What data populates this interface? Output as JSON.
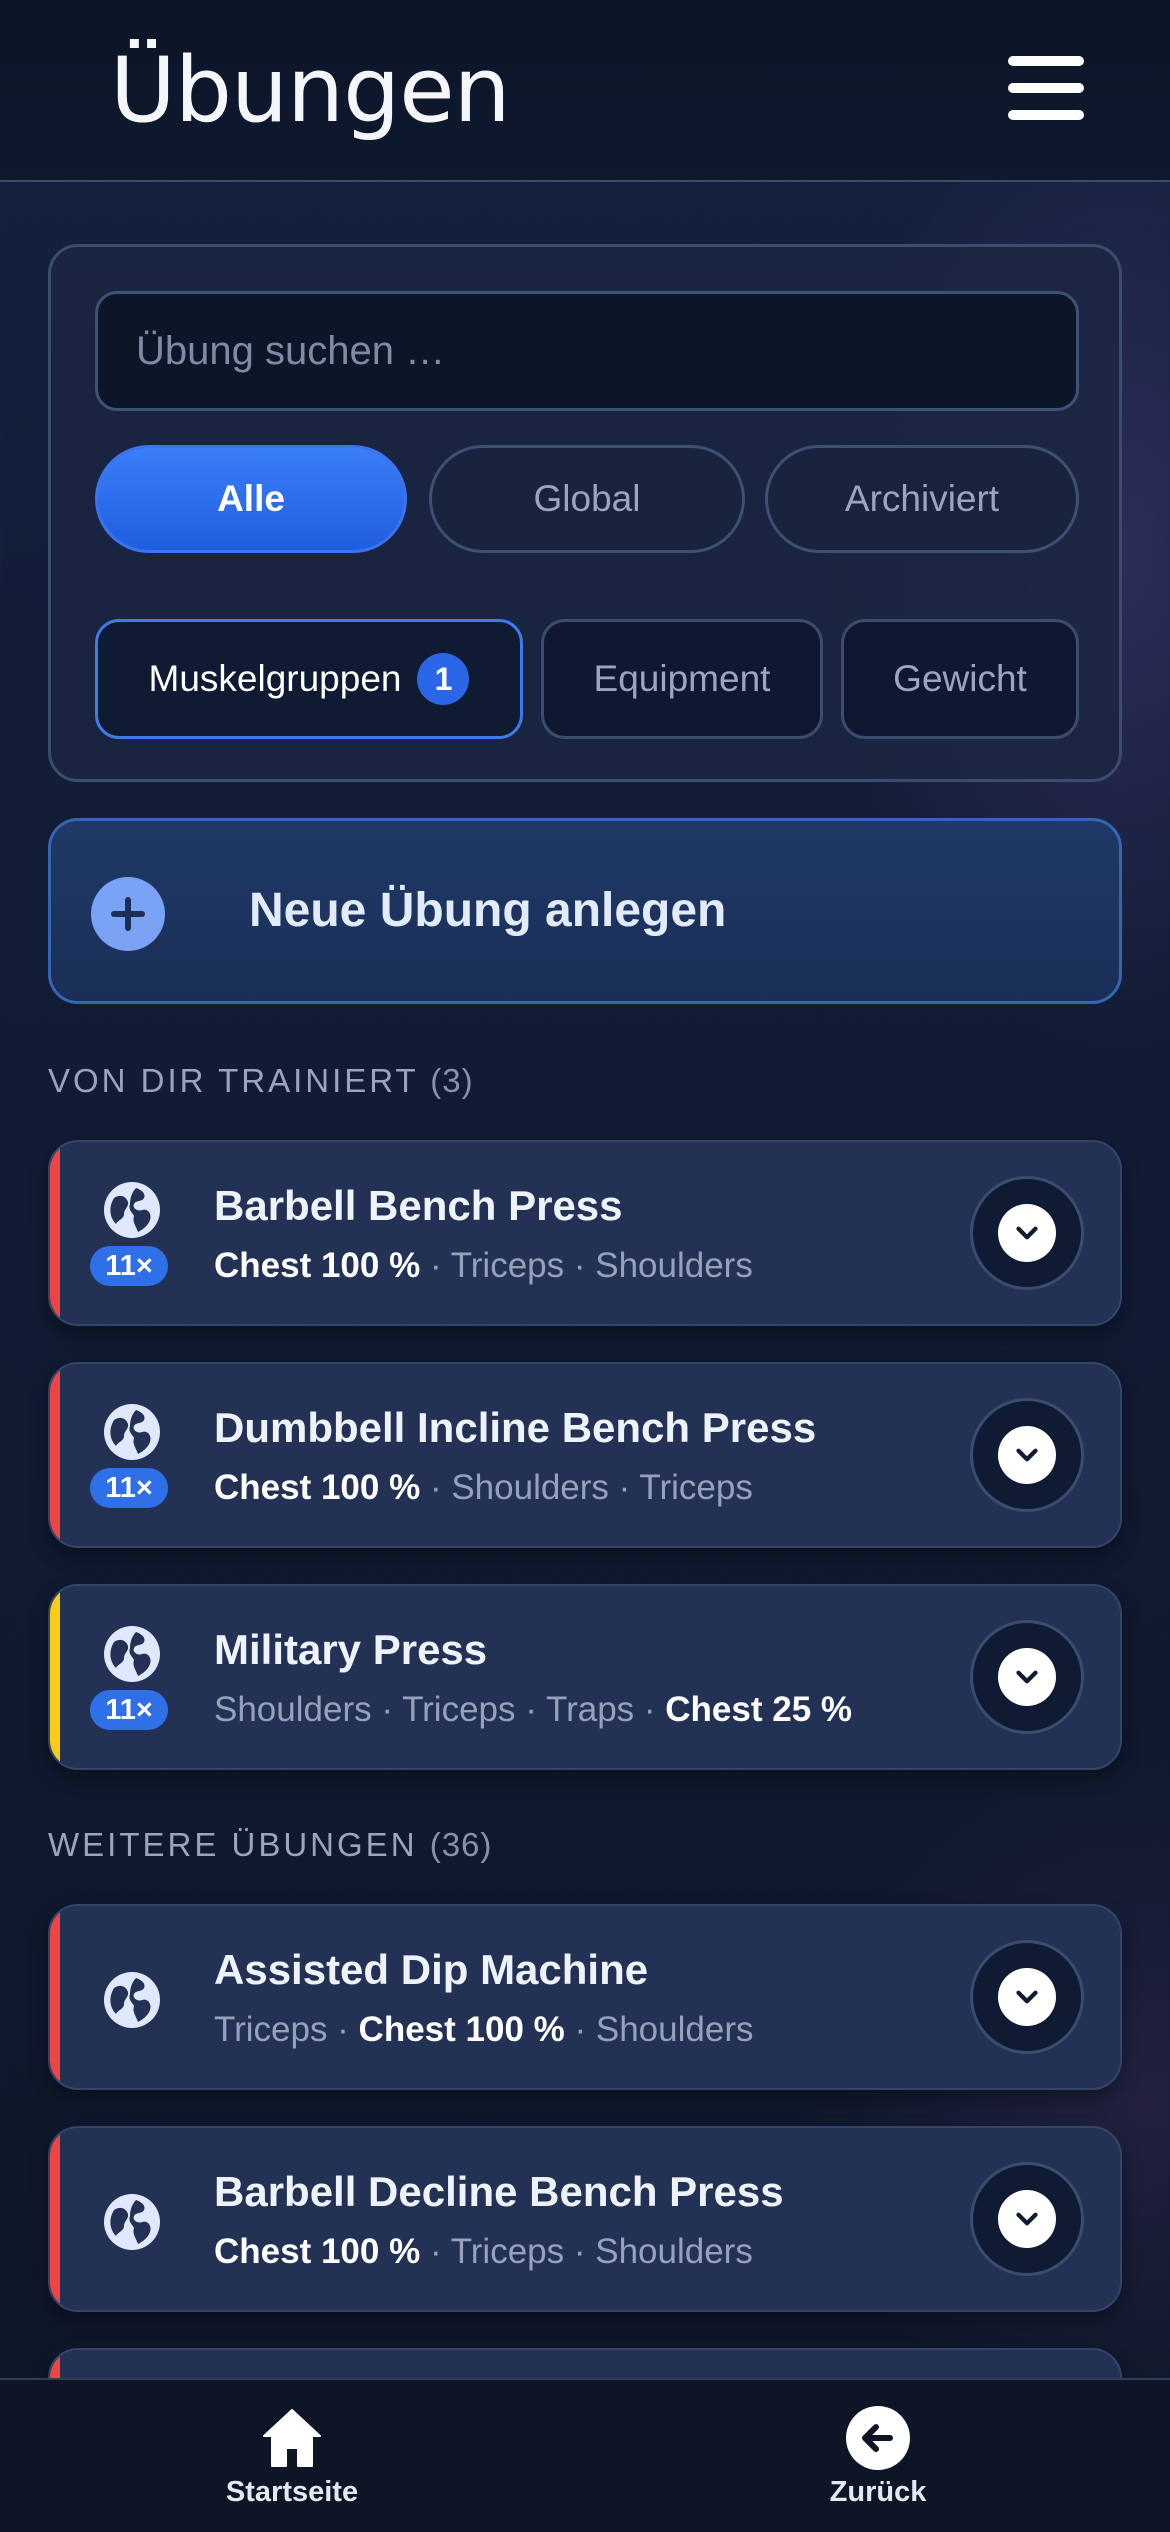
{
  "header": {
    "title": "Übungen",
    "menu_icon": "hamburger-menu-icon"
  },
  "filters": {
    "search_placeholder": "Übung suchen …",
    "scopes": [
      {
        "label": "Alle",
        "active": true
      },
      {
        "label": "Global",
        "active": false
      },
      {
        "label": "Archiviert",
        "active": false
      }
    ],
    "facets": [
      {
        "label": "Muskelgruppen",
        "count": "1",
        "selected": true
      },
      {
        "label": "Equipment",
        "selected": false
      },
      {
        "label": "Gewicht",
        "selected": false
      }
    ]
  },
  "new_exercise": {
    "label": "Neue Übung anlegen",
    "icon": "plus-circle-icon"
  },
  "sections": {
    "trained": {
      "label": "VON DIR TRAINIERT",
      "count": "(3)"
    },
    "more": {
      "label": "WEITERE ÜBUNGEN",
      "count": "(36)"
    }
  },
  "trained_exercises": [
    {
      "name": "Barbell Bench Press",
      "uses": "11×",
      "accent": "#ef4444",
      "muscles": [
        {
          "text": "Chest 100 %",
          "primary": true
        },
        {
          "text": " · Triceps · Shoulders",
          "primary": false
        }
      ]
    },
    {
      "name": "Dumbbell Incline Bench Press",
      "uses": "11×",
      "accent": "#ef4444",
      "muscles": [
        {
          "text": "Chest 100 %",
          "primary": true
        },
        {
          "text": " · Shoulders · Triceps",
          "primary": false
        }
      ]
    },
    {
      "name": "Military Press",
      "uses": "11×",
      "accent": "#facc15",
      "muscles": [
        {
          "text": "Shoulders · Triceps · Traps · ",
          "primary": false
        },
        {
          "text": "Chest 25 %",
          "primary": true
        }
      ]
    }
  ],
  "more_exercises": [
    {
      "name": "Assisted Dip Machine",
      "accent": "#ef4444",
      "muscles": [
        {
          "text": "Triceps · ",
          "primary": false
        },
        {
          "text": "Chest 100 %",
          "primary": true
        },
        {
          "text": " · Shoulders",
          "primary": false
        }
      ]
    },
    {
      "name": "Barbell Decline Bench Press",
      "accent": "#ef4444",
      "muscles": [
        {
          "text": "Chest 100 %",
          "primary": true
        },
        {
          "text": " · Triceps · Shoulders",
          "primary": false
        }
      ]
    }
  ],
  "bottom_nav": {
    "home": {
      "label": "Startseite",
      "icon": "home-icon"
    },
    "back": {
      "label": "Zurück",
      "icon": "arrow-left-circle-icon"
    }
  },
  "colors": {
    "accent_blue": "#2f6fe8",
    "accent_red": "#ef4444",
    "accent_yellow": "#facc15",
    "card_bg": "#233154"
  }
}
